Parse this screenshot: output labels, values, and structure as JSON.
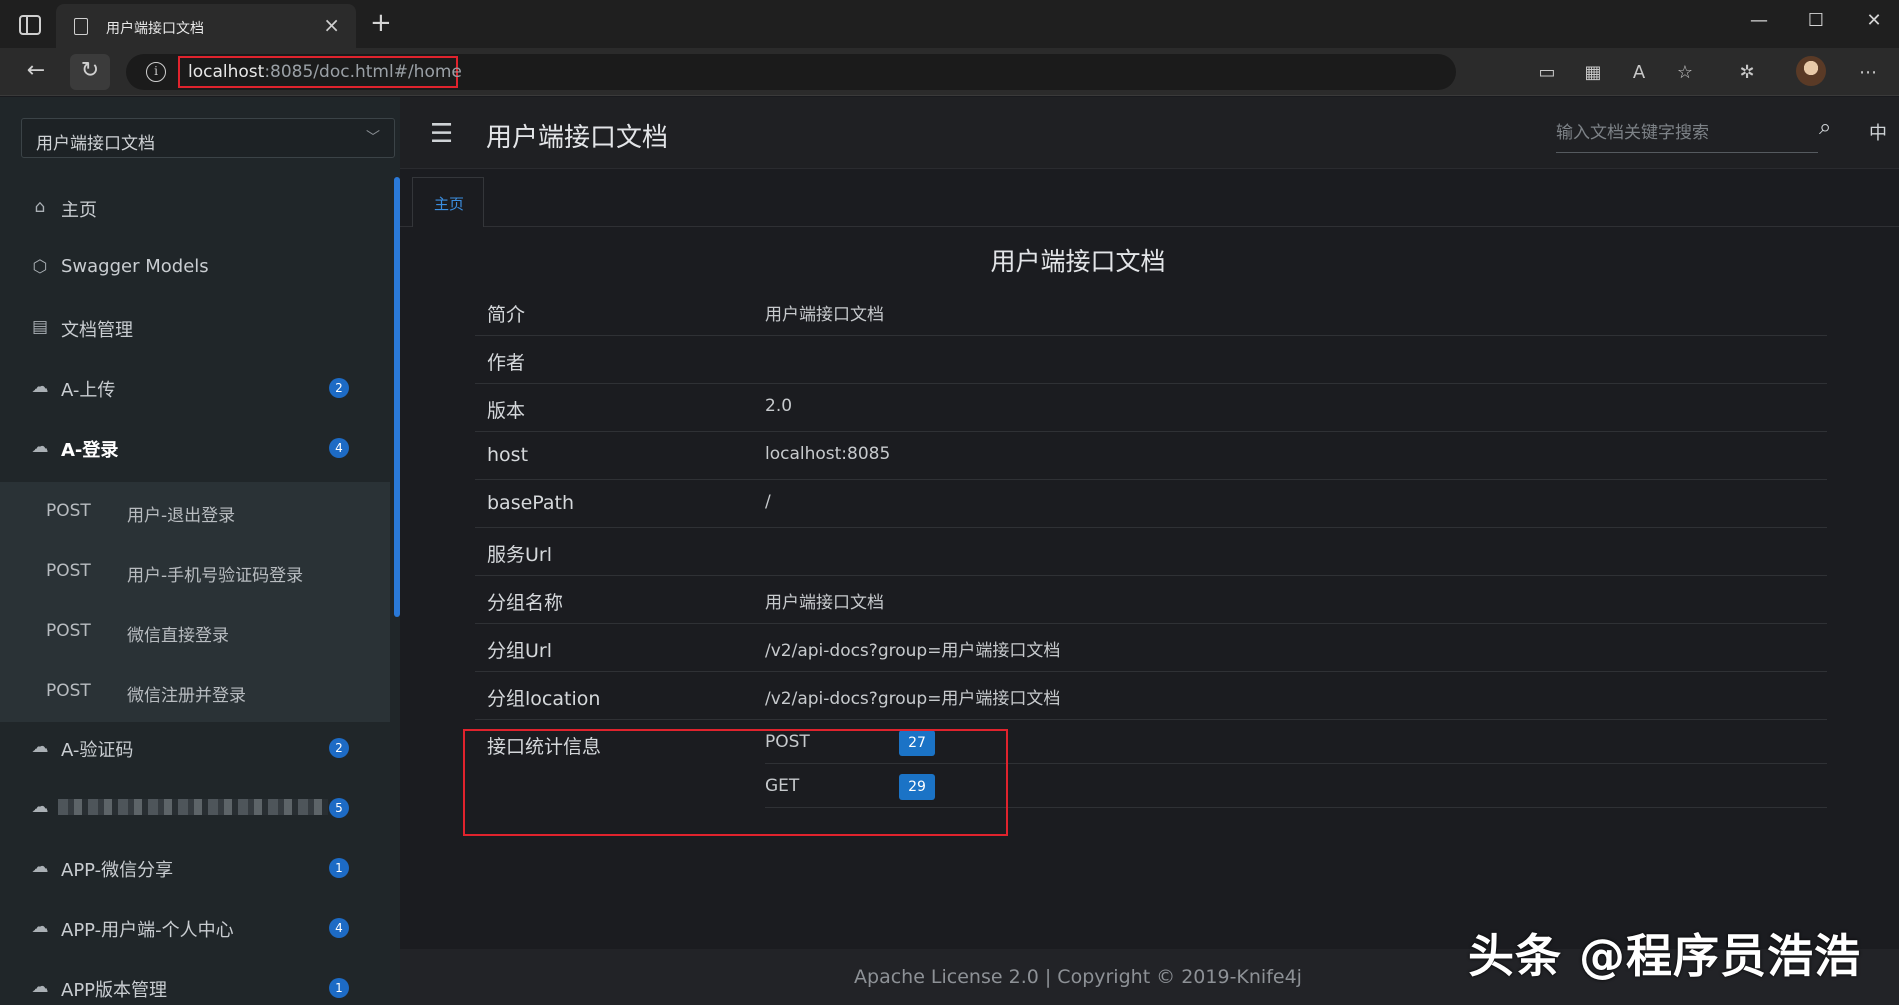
{
  "browser": {
    "tab_title": "用户端接口文档",
    "close_label": "×",
    "new_tab_label": "+",
    "win_min": "—",
    "win_max": "☐",
    "win_close": "✕",
    "url_host": "localhost",
    "url_rest": ":8085/doc.html#/home"
  },
  "app": {
    "group_select": "用户端接口文档",
    "page_title": "用户端接口文档",
    "search_placeholder": "输入文档关键字搜索",
    "lang": "中",
    "home_tab": "主页"
  },
  "sidebar": {
    "items": [
      {
        "label": "主页",
        "icon": "home-icon",
        "badge": ""
      },
      {
        "label": "Swagger Models",
        "icon": "cube-icon",
        "badge": ""
      },
      {
        "label": "文档管理",
        "icon": "doc-settings-icon",
        "badge": ""
      },
      {
        "label": "A-上传",
        "icon": "cloud-icon",
        "badge": "2"
      },
      {
        "label": "A-登录",
        "icon": "cloud-icon",
        "badge": "4"
      },
      {
        "label": "A-验证码",
        "icon": "cloud-icon",
        "badge": "2"
      },
      {
        "label": "",
        "icon": "cloud-icon",
        "badge": "5"
      },
      {
        "label": "APP-微信分享",
        "icon": "cloud-icon",
        "badge": "1"
      },
      {
        "label": "APP-用户端-个人中心",
        "icon": "cloud-icon",
        "badge": "4"
      },
      {
        "label": "APP版本管理",
        "icon": "cloud-icon",
        "badge": "1"
      }
    ],
    "sub_items": [
      {
        "method": "POST",
        "label": "用户-退出登录"
      },
      {
        "method": "POST",
        "label": "用户-手机号验证码登录"
      },
      {
        "method": "POST",
        "label": "微信直接登录"
      },
      {
        "method": "POST",
        "label": "微信注册并登录"
      }
    ]
  },
  "doc": {
    "title": "用户端接口文档",
    "rows": [
      {
        "key": "简介",
        "value": "用户端接口文档"
      },
      {
        "key": "作者",
        "value": ""
      },
      {
        "key": "版本",
        "value": "2.0"
      },
      {
        "key": "host",
        "value": "localhost:8085"
      },
      {
        "key": "basePath",
        "value": "/"
      },
      {
        "key": "服务Url",
        "value": ""
      },
      {
        "key": "分组名称",
        "value": "用户端接口文档"
      },
      {
        "key": "分组Url",
        "value": "/v2/api-docs?group=用户端接口文档"
      },
      {
        "key": "分组location",
        "value": "/v2/api-docs?group=用户端接口文档"
      }
    ],
    "stats_label": "接口统计信息",
    "stats": [
      {
        "method": "POST",
        "count": "27"
      },
      {
        "method": "GET",
        "count": "29"
      }
    ]
  },
  "footer": "Apache License 2.0 | Copyright © 2019-Knife4j",
  "watermark": "头条 @程序员浩浩",
  "colors": {
    "accent": "#1d6bc5",
    "highlight": "#e0232d",
    "link": "#3b8ee0"
  }
}
